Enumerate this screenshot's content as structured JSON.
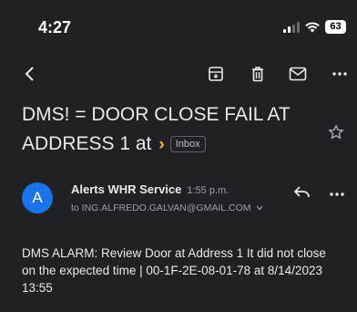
{
  "status": {
    "time": "4:27",
    "battery": "63"
  },
  "toolbar": {
    "back_icon": "chevron-left-icon",
    "archive_icon": "archive-icon",
    "delete_icon": "trash-icon",
    "mark_unread_icon": "mail-icon",
    "more_icon": "more-horizontal-icon"
  },
  "email": {
    "subject": "DMS! = DOOR CLOSE FAIL AT ADDRESS 1 at",
    "importance_marker": "›",
    "label": "Inbox",
    "sender_initial": "A",
    "sender_name": "Alerts WHR Service",
    "sent_time": "1:55 p.m.",
    "to": "to ING.ALFREDO.GALVAN@GMAIL.COM",
    "body": "DMS ALARM: Review Door at Address 1 It did not close on the expected time | 00-1F-2E-08-01-78 at 8/14/2023 13:55"
  },
  "colors": {
    "background": "#202124",
    "accent_avatar": "#1a73e8",
    "importance": "#fbbc04"
  }
}
